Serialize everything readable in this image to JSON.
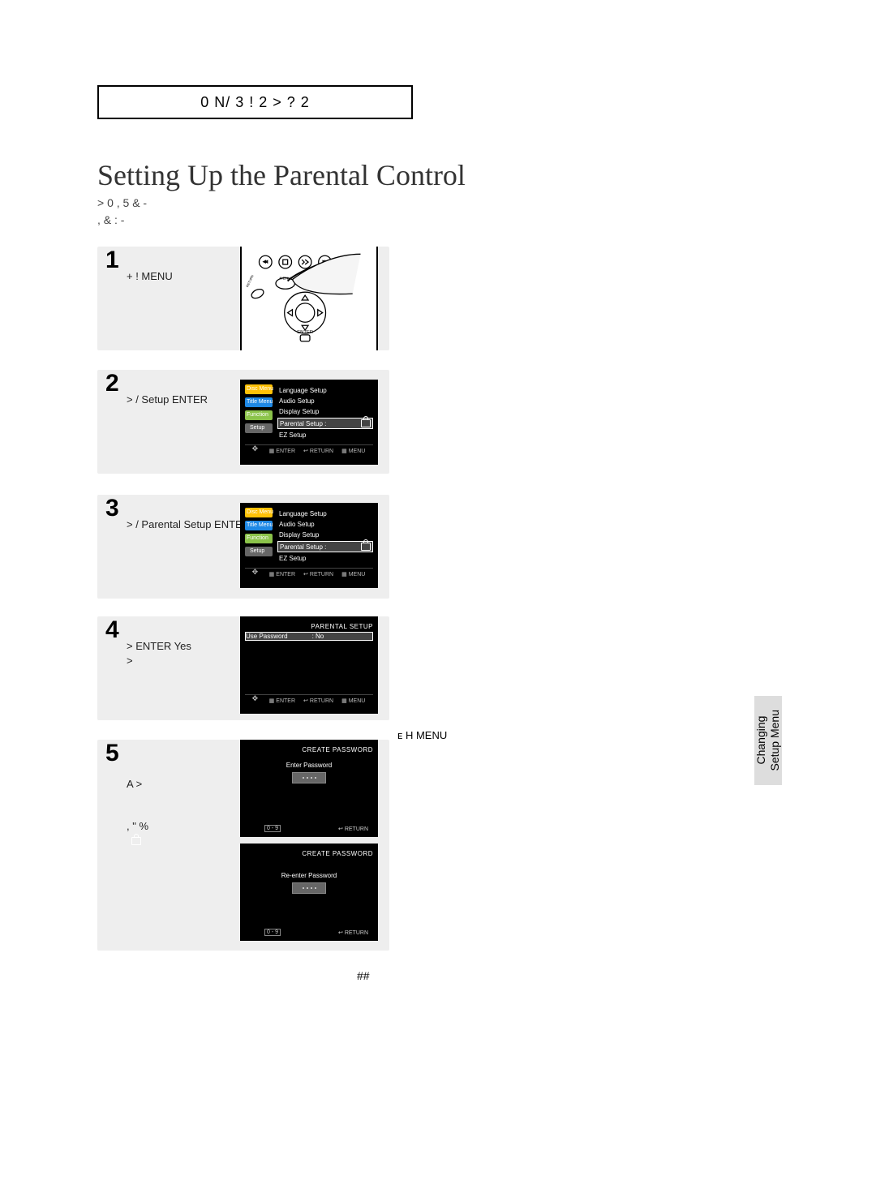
{
  "category_box": "0 N/ 3   !   2 > ?   2",
  "title": "Setting Up the Parental Control",
  "intro": ">       0          ,       5        &        -\n                              ,  &                                          :         -",
  "steps": {
    "s1": {
      "num": "1",
      "text": "+        !                          MENU"
    },
    "s2": {
      "num": "2",
      "text": ">             /               Setup                 ENTER"
    },
    "s3": {
      "num": "3",
      "text": ">             /             Parental Setup               ENTER"
    },
    "s4": {
      "num": "4",
      "text": ">                 ENTER                 Yes\n               >"
    },
    "s5": {
      "num": "5",
      "text": "A      >\n\n\n         ,   \"    %"
    }
  },
  "screens": {
    "setup_menu": {
      "side": {
        "disc": "Disc Menu",
        "title": "Title Menu",
        "func": "Function",
        "setup": "Setup"
      },
      "items": [
        "Language Setup",
        "Audio Setup",
        "Display Setup",
        "Parental Setup :",
        "EZ Setup"
      ],
      "footer": {
        "enter": "ENTER",
        "return": "RETURN",
        "menu": "MENU"
      }
    },
    "parental_title": "PARENTAL SETUP",
    "use_pw_label": "Use Password",
    "use_pw_value": ": No",
    "create_pw_title": "CREATE PASSWORD",
    "enter_pw": "Enter Password",
    "reenter_pw": "Re-enter Password",
    "numkeys": "0 - 9",
    "return_label": "RETURN"
  },
  "note": "ᴇ     H                                                MENU",
  "sidetab": {
    "line1": "Changing",
    "line2": "Setup Menu"
  },
  "page_number": "##"
}
